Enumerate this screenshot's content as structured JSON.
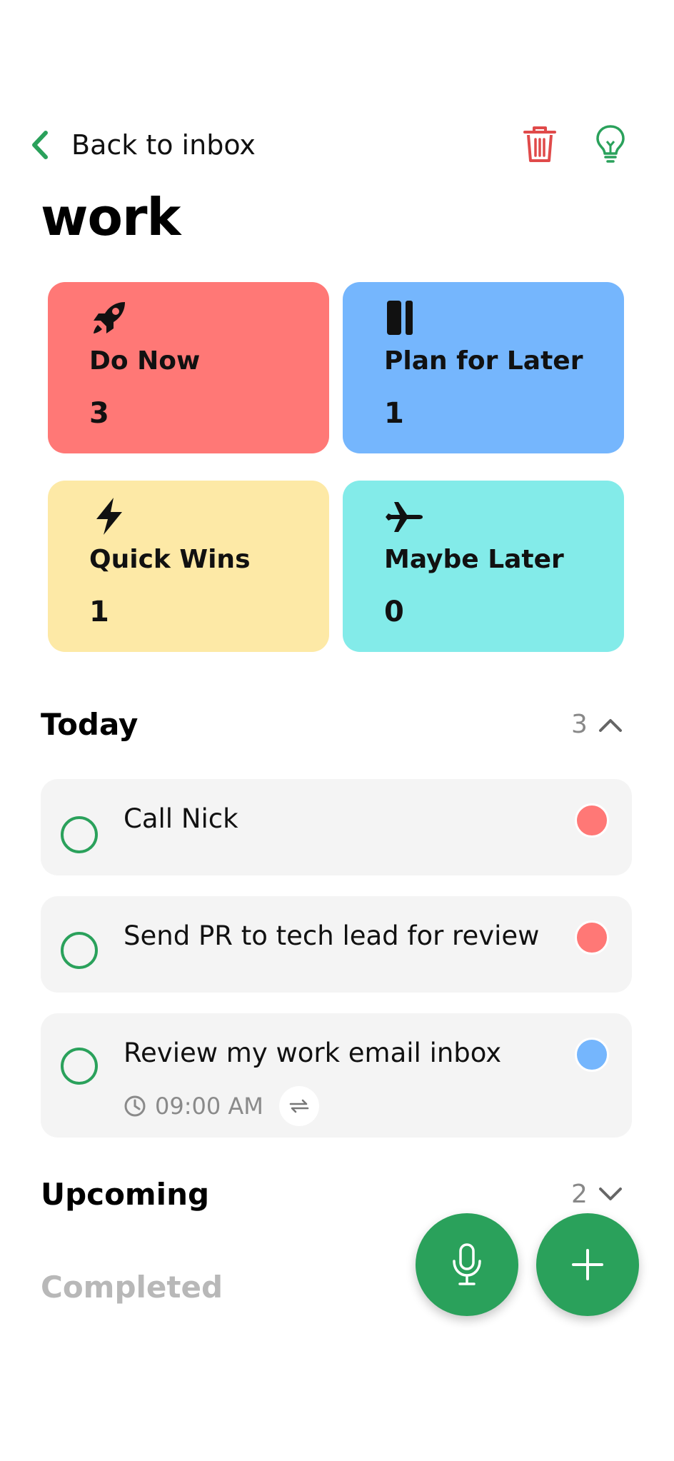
{
  "header": {
    "back_label": "Back to inbox",
    "title": "work"
  },
  "categories": [
    {
      "label": "Do Now",
      "count": "3",
      "color": "#ff7876",
      "icon": "rocket-icon"
    },
    {
      "label": "Plan for Later",
      "count": "1",
      "color": "#75b6fd",
      "icon": "pause-icon"
    },
    {
      "label": "Quick Wins",
      "count": "1",
      "color": "#fde9a6",
      "icon": "bolt-icon"
    },
    {
      "label": "Maybe Later",
      "count": "0",
      "color": "#83ebe9",
      "icon": "airplane-icon"
    }
  ],
  "today": {
    "title": "Today",
    "count": "3",
    "expanded": true,
    "tasks": [
      {
        "label": "Call Nick",
        "priority_color": "#ff7876"
      },
      {
        "label": "Send PR to tech lead for review",
        "priority_color": "#ff7876"
      },
      {
        "label": "Review my work email inbox",
        "priority_color": "#75b6fd",
        "time": "09:00 AM",
        "repeat": true
      }
    ]
  },
  "upcoming": {
    "title": "Upcoming",
    "count": "2",
    "expanded": false
  },
  "completed": {
    "title": "Completed"
  },
  "colors": {
    "accent": "#2aa15b",
    "danger": "#e04a4a"
  },
  "fabs": {
    "mic": "microphone-icon",
    "add": "plus-icon"
  }
}
